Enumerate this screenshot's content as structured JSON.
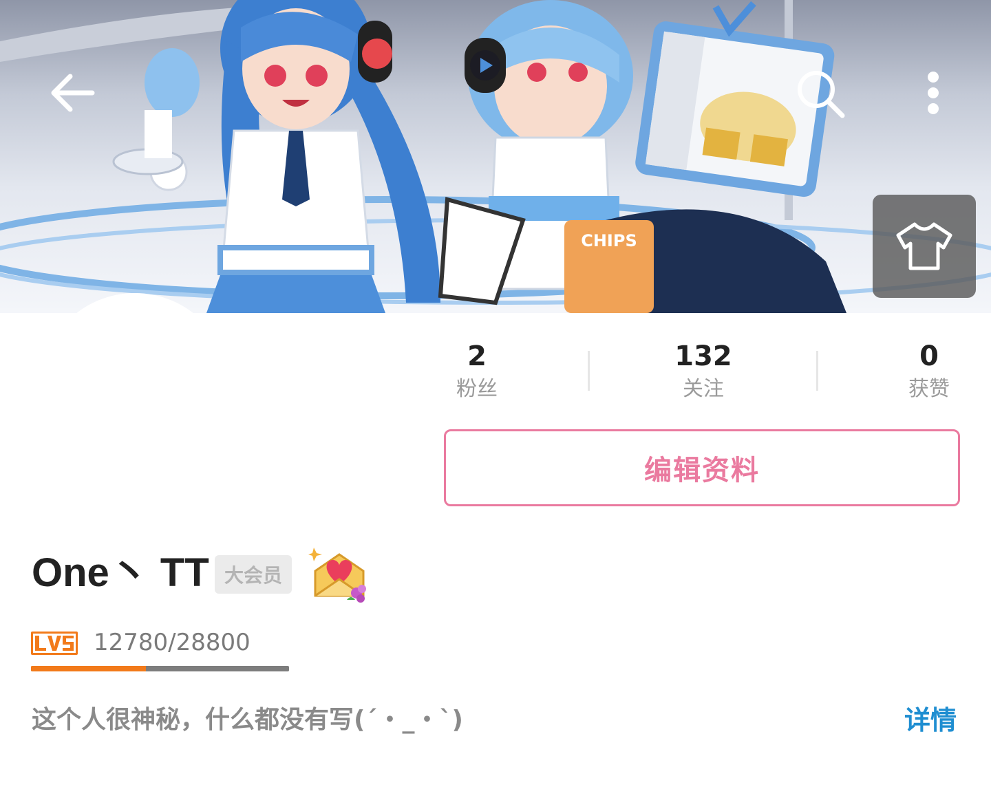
{
  "header": {
    "icons": {
      "back": "arrow-left-icon",
      "search": "search-icon",
      "more": "more-vertical-icon",
      "skin": "tshirt-icon"
    },
    "banner_text": "CHIPS"
  },
  "stats": {
    "fans": {
      "value": "2",
      "label": "粉丝"
    },
    "following": {
      "value": "132",
      "label": "关注"
    },
    "likes": {
      "value": "0",
      "label": "获赞"
    }
  },
  "profile": {
    "edit_label": "编辑资料",
    "username": "One丶 TT",
    "vip_badge": "大会员",
    "pendant_icon": "heart-envelope-icon",
    "level": {
      "label": "LV5",
      "exp_text": "12780/28800",
      "progress": 0.444
    },
    "bio": "这个人很神秘，什么都没有写(´・_・`)",
    "detail_label": "详情"
  },
  "colors": {
    "accent_pink": "#ea7a9f",
    "link_blue": "#1f8ed1",
    "level_orange": "#f27a1a"
  }
}
